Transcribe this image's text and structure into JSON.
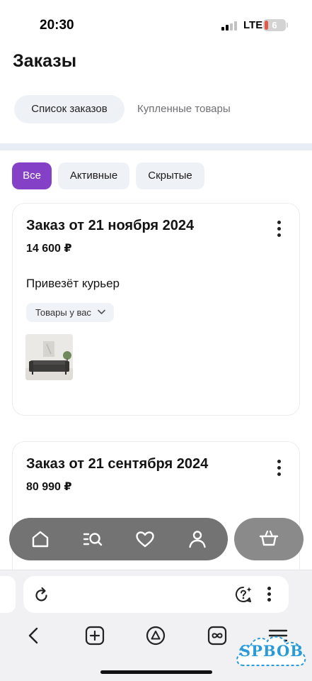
{
  "status_bar": {
    "time": "20:30",
    "network": "LTE",
    "battery": "6"
  },
  "header": {
    "title": "Заказы"
  },
  "tabs": [
    {
      "label": "Список заказов",
      "active": true
    },
    {
      "label": "Купленные товары",
      "active": false
    }
  ],
  "filters": [
    {
      "label": "Все",
      "active": true
    },
    {
      "label": "Активные",
      "active": false
    },
    {
      "label": "Скрытые",
      "active": false
    }
  ],
  "orders": [
    {
      "title": "Заказ от 21 ноября 2024",
      "price": "14 600 ₽",
      "status": "Привезёт курьер",
      "goods_label": "Товары у вас",
      "thumbnail": "sofa-photo"
    },
    {
      "title": "Заказ от 21 сентября 2024",
      "price": "80 990 ₽"
    }
  ],
  "bottom_nav": {
    "items": [
      "home-icon",
      "catalog-search-icon",
      "heart-icon",
      "profile-icon"
    ],
    "cart": "basket-icon"
  },
  "browser": {
    "toolbar": [
      "back-icon",
      "new-tab-icon",
      "alice-icon",
      "tabs-icon",
      "menu-icon"
    ]
  },
  "watermark": "SPBOB",
  "colors": {
    "accent": "#8440c6",
    "chip_bg": "#eef1f6",
    "nav_bg": "#737373",
    "watermark": "#2a9bd8"
  }
}
